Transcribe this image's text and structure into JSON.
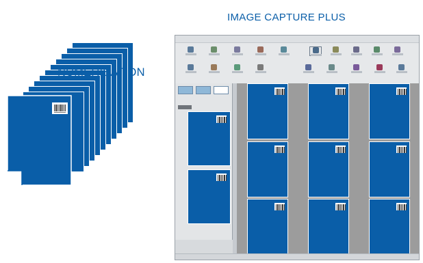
{
  "diagram": {
    "stack_label": "NUMÉRISATION",
    "app_title": "IMAGE CAPTURE PLUS"
  },
  "colors": {
    "document_blue": "#0a5ea8",
    "window_gray": "#9c9c9c"
  },
  "icons": {
    "barcode": "barcode-icon",
    "document": "document-icon"
  }
}
